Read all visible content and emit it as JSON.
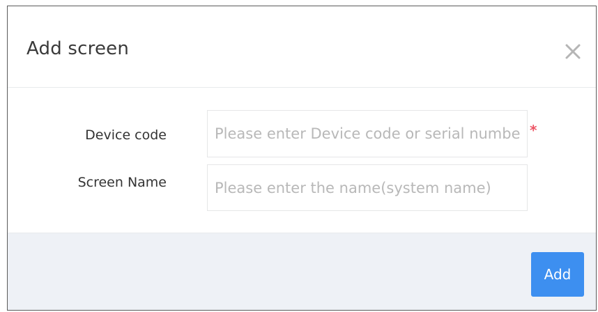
{
  "dialog": {
    "title": "Add screen",
    "close_icon": "close-icon"
  },
  "form": {
    "device_code": {
      "label": "Device code",
      "placeholder": "Please enter Device code or serial number",
      "value": "",
      "required_marker": "*"
    },
    "screen_name": {
      "label": "Screen Name",
      "placeholder": "Please enter the name(system name)",
      "value": ""
    }
  },
  "footer": {
    "add_label": "Add"
  },
  "colors": {
    "primary_button": "#3d8ff0",
    "required_star": "#ed5565",
    "footer_background": "#eef1f6"
  }
}
